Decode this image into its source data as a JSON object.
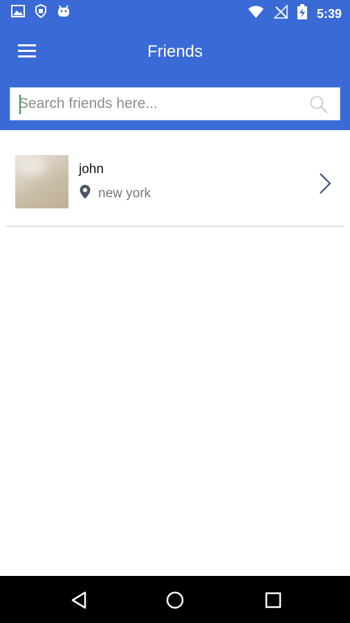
{
  "status_bar": {
    "time": "5:39",
    "left_icons": [
      "image-icon",
      "shield-icon",
      "android-icon"
    ],
    "right_icons": [
      "wifi-icon",
      "no-signal-icon",
      "battery-charging-icon"
    ]
  },
  "app_bar": {
    "title": "Friends",
    "menu_icon": "menu-icon"
  },
  "search": {
    "placeholder": "Search friends here...",
    "value": "",
    "icon": "search-icon"
  },
  "friends": [
    {
      "name": "john",
      "location": "new york"
    }
  ],
  "nav": {
    "back_icon": "back-icon",
    "home_icon": "home-icon",
    "recents_icon": "recents-icon"
  },
  "colors": {
    "primary": "#3a6ad6",
    "nav_bar": "#000000",
    "name_text": "#111111",
    "location_text": "#777777",
    "caret": "#1aa34a"
  }
}
